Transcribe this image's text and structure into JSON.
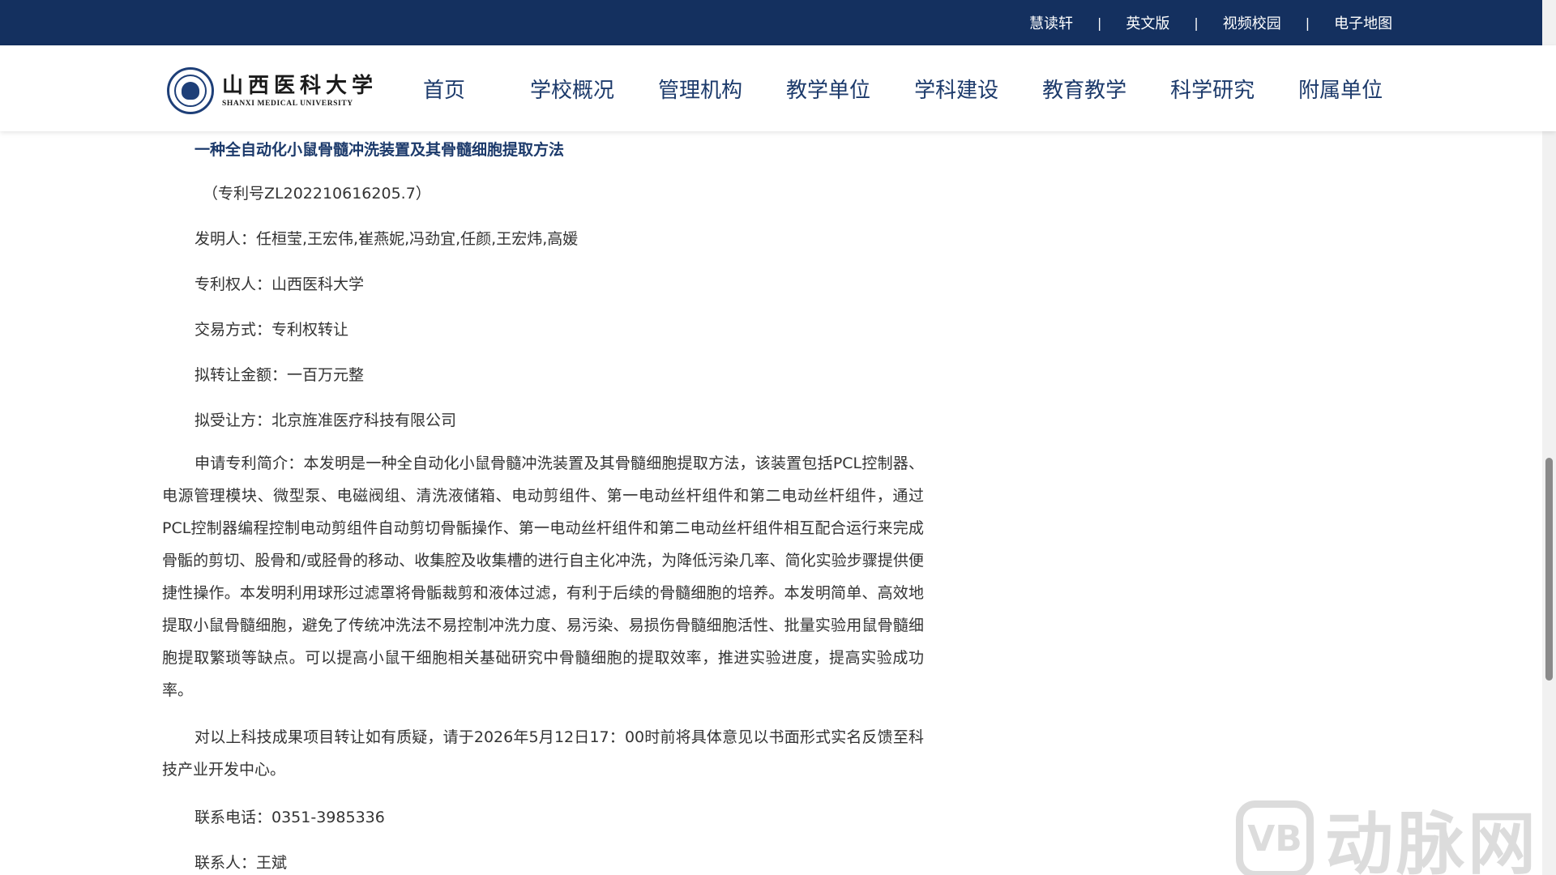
{
  "topbar": {
    "links": [
      "慧读轩",
      "英文版",
      "视频校园",
      "电子地图"
    ],
    "separator": "|",
    "background": "#14305f"
  },
  "header": {
    "logo": {
      "cn": "山西医科大学",
      "en": "SHANXI MEDICAL UNIVERSITY",
      "icon": "university-seal-icon"
    },
    "nav": [
      "首页",
      "学校概况",
      "管理机构",
      "教学单位",
      "学科建设",
      "教育教学",
      "科学研究",
      "附属单位"
    ]
  },
  "article": {
    "title": "一种全自动化小鼠骨髓冲洗装置及其骨髓细胞提取方法",
    "patent_no": "（专利号ZL202210616205.7）",
    "inventors": "发明人：任桓莹,王宏伟,崔燕妮,冯劲宜,任颜,王宏炜,高媛",
    "patentee": "专利权人：山西医科大学",
    "trade_method": "交易方式：专利权转让",
    "amount": "拟转让金额：一百万元整",
    "assignee": "拟受让方：北京旌准医疗科技有限公司",
    "abstract": "申请专利简介：本发明是一种全自动化小鼠骨髓冲洗装置及其骨髓细胞提取方法，该装置包括PCL控制器、电源管理模块、微型泵、电磁阀组、清洗液储箱、电动剪组件、第一电动丝杆组件和第二电动丝杆组件，通过PCL控制器编程控制电动剪组件自动剪切骨骺操作、第一电动丝杆组件和第二电动丝杆组件相互配合运行来完成骨骺的剪切、股骨和/或胫骨的移动、收集腔及收集槽的进行自主化冲洗，为降低污染几率、简化实验步骤提供便捷性操作。本发明利用球形过滤罩将骨骺裁剪和液体过滤，有利于后续的骨髓细胞的培养。本发明简单、高效地提取小鼠骨髓细胞，避免了传统冲洗法不易控制冲洗力度、易污染、易损伤骨髓细胞活性、批量实验用鼠骨髓细胞提取繁琐等缺点。可以提高小鼠干细胞相关基础研究中骨髓细胞的提取效率，推进实验进度，提高实验成功率。",
    "notice": "对以上科技成果项目转让如有质疑，请于2026年5月12日17：00时前将具体意见以书面形式实名反馈至科技产业开发中心。",
    "phone": "联系电话：0351-3985336",
    "contact": "联系人：王斌"
  },
  "watermark": {
    "badge": "VB",
    "text": "动脉网"
  },
  "colors": {
    "accent": "#1c3a6b",
    "body_text": "#333333"
  }
}
